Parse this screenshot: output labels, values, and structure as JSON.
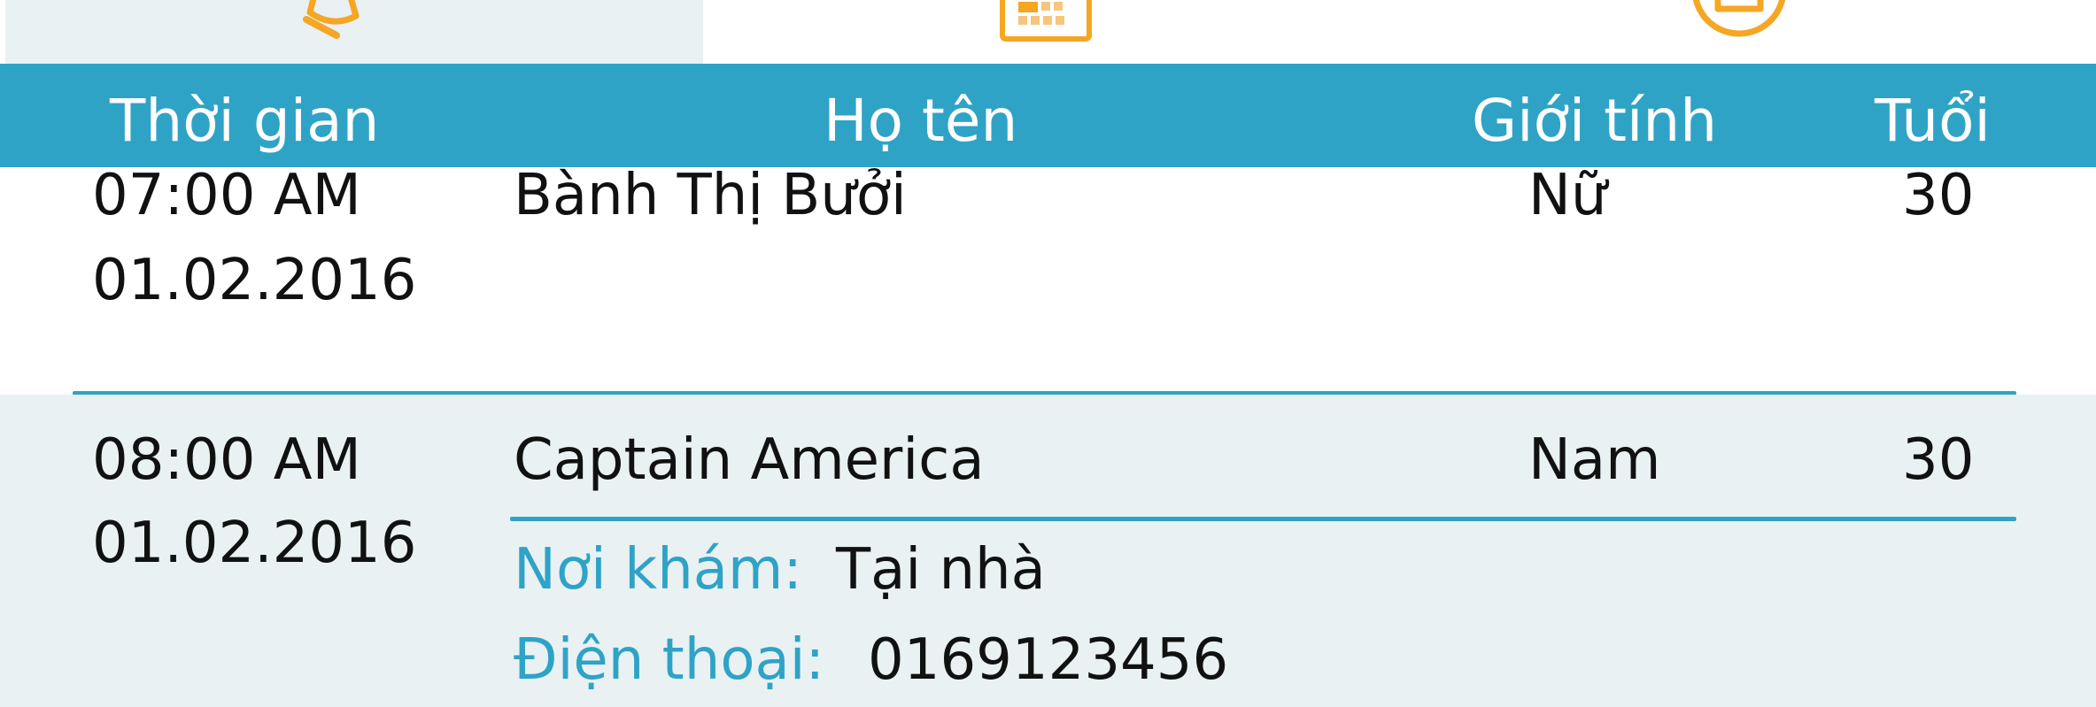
{
  "tabs": [
    {
      "icon": "bell-icon",
      "active": true
    },
    {
      "icon": "calendar-icon",
      "active": false
    },
    {
      "icon": "clipboard-icon",
      "active": false
    }
  ],
  "colors": {
    "accent": "#2fa3c6",
    "icon": "#f5a623",
    "row_alt": "#e9f1f3"
  },
  "table": {
    "headers": {
      "time": "Thời gian",
      "name": "Họ tên",
      "gender": "Giới tính",
      "age": "Tuổi"
    },
    "rows": [
      {
        "time": "07:00 AM",
        "date": "01.02.2016",
        "name": "Bành Thị Bưởi",
        "gender": "Nữ",
        "age": "30"
      },
      {
        "time": "08:00 AM",
        "date": "01.02.2016",
        "name": "Captain America",
        "gender": "Nam",
        "age": "30",
        "details": {
          "place_label": "Nơi khám:",
          "place_value": "Tại nhà",
          "phone_label": "Điện thoại:",
          "phone_value": "0169123456"
        }
      }
    ]
  }
}
